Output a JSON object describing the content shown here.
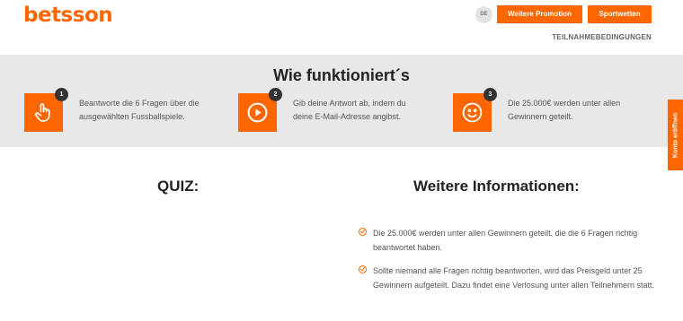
{
  "header": {
    "logo": "betsson",
    "lang": "DE",
    "promo_label": "Weitere Promotion",
    "sports_label": "Sportwetten",
    "terms_label": "TEILNAHMEBEDINGUNGEN"
  },
  "how": {
    "title": "Wie funktioniert´s",
    "steps": [
      {
        "num": "1",
        "text": "Beantworte die 6 Fragen über die ausgewählten Fussballspiele.",
        "icon": "hand-pointer-icon"
      },
      {
        "num": "2",
        "text": "Gib deine Antwort ab, indem du deine E-Mail-Adresse angibst.",
        "icon": "play-icon"
      },
      {
        "num": "3",
        "text": "Die 25.000€ werden unter allen Gewinnern geteilt.",
        "icon": "smiley-icon"
      }
    ]
  },
  "side_tab": {
    "label": "Konto eröffnen"
  },
  "quiz": {
    "title": "QUIZ:"
  },
  "info": {
    "title": "Weitere Informationen:",
    "items": [
      "Die 25.000€ werden unter allen Gewinnern geteilt, die die 6 Fragen richtig beantwortet haben.",
      "Sollte niemand alle Fragen richtig beantworten, wird das Preisgeld unter 25 Gewinnern aufgeteilt. Dazu findet eine Verlosung unter allen Teilnehmern statt."
    ]
  },
  "colors": {
    "accent": "#ff6600",
    "band": "#e8e8e8"
  }
}
